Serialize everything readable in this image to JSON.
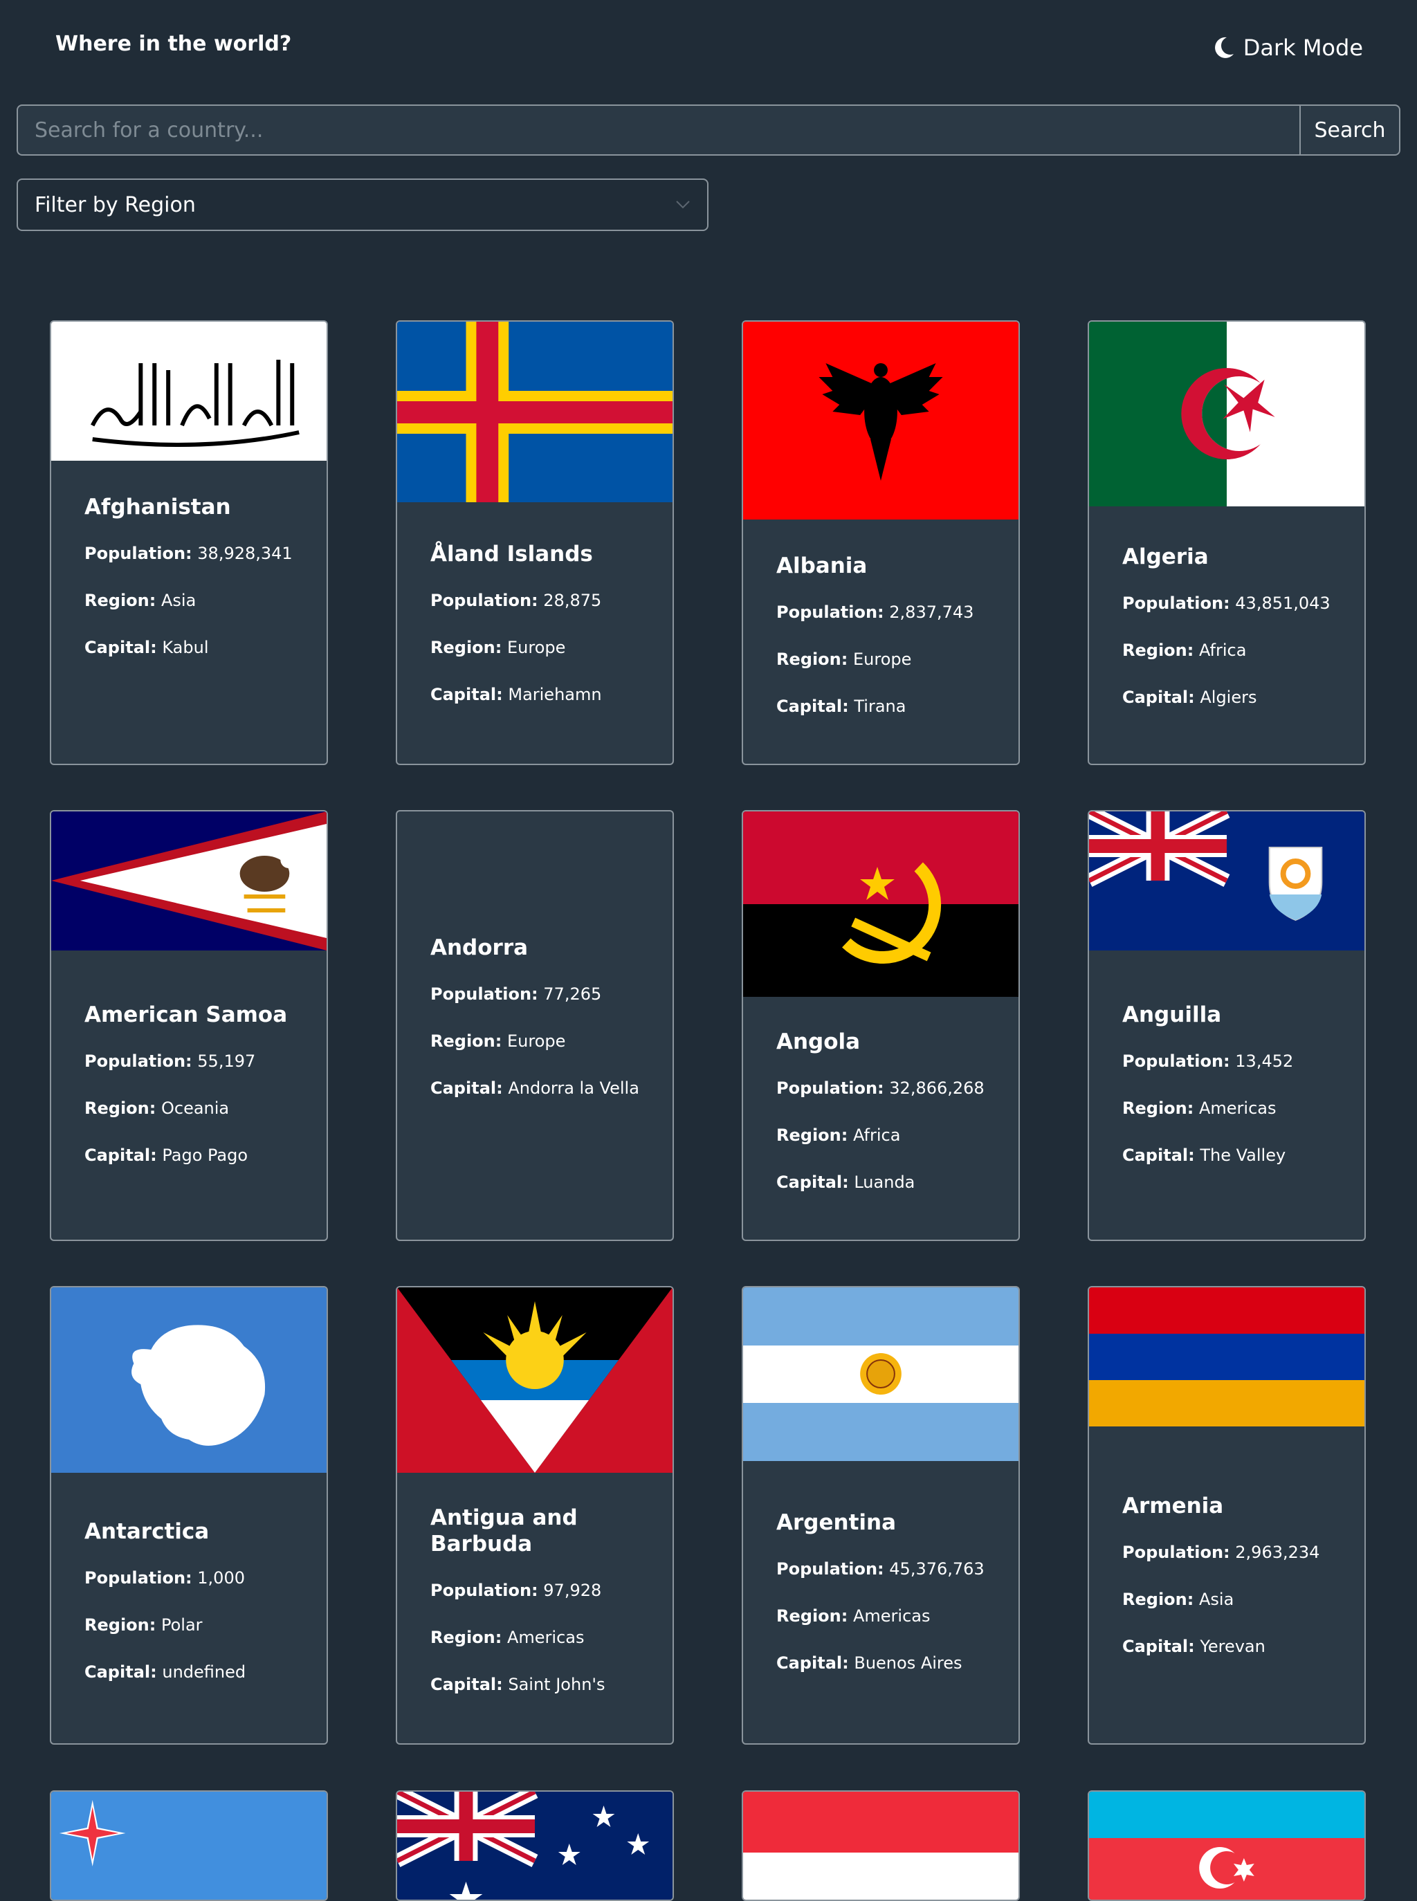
{
  "header": {
    "title": "Where in the world?",
    "dark_mode_label": "Dark Mode"
  },
  "search": {
    "placeholder": "Search for a country...",
    "button_label": "Search"
  },
  "filter": {
    "label": "Filter by Region"
  },
  "labels": {
    "population": "Population:",
    "region": "Region:",
    "capital": "Capital:"
  },
  "countries": [
    {
      "name": "Afghanistan",
      "population": "38,928,341",
      "region": "Asia",
      "capital": "Kabul"
    },
    {
      "name": "Åland Islands",
      "population": "28,875",
      "region": "Europe",
      "capital": "Mariehamn"
    },
    {
      "name": "Albania",
      "population": "2,837,743",
      "region": "Europe",
      "capital": "Tirana"
    },
    {
      "name": "Algeria",
      "population": "43,851,043",
      "region": "Africa",
      "capital": "Algiers"
    },
    {
      "name": "American Samoa",
      "population": "55,197",
      "region": "Oceania",
      "capital": "Pago Pago"
    },
    {
      "name": "Andorra",
      "population": "77,265",
      "region": "Europe",
      "capital": "Andorra la Vella"
    },
    {
      "name": "Angola",
      "population": "32,866,268",
      "region": "Africa",
      "capital": "Luanda"
    },
    {
      "name": "Anguilla",
      "population": "13,452",
      "region": "Americas",
      "capital": "The Valley"
    },
    {
      "name": "Antarctica",
      "population": "1,000",
      "region": "Polar",
      "capital": "undefined"
    },
    {
      "name": "Antigua and Barbuda",
      "population": "97,928",
      "region": "Americas",
      "capital": "Saint John's"
    },
    {
      "name": "Argentina",
      "population": "45,376,763",
      "region": "Americas",
      "capital": "Buenos Aires"
    },
    {
      "name": "Armenia",
      "population": "2,963,234",
      "region": "Asia",
      "capital": "Yerevan"
    }
  ]
}
